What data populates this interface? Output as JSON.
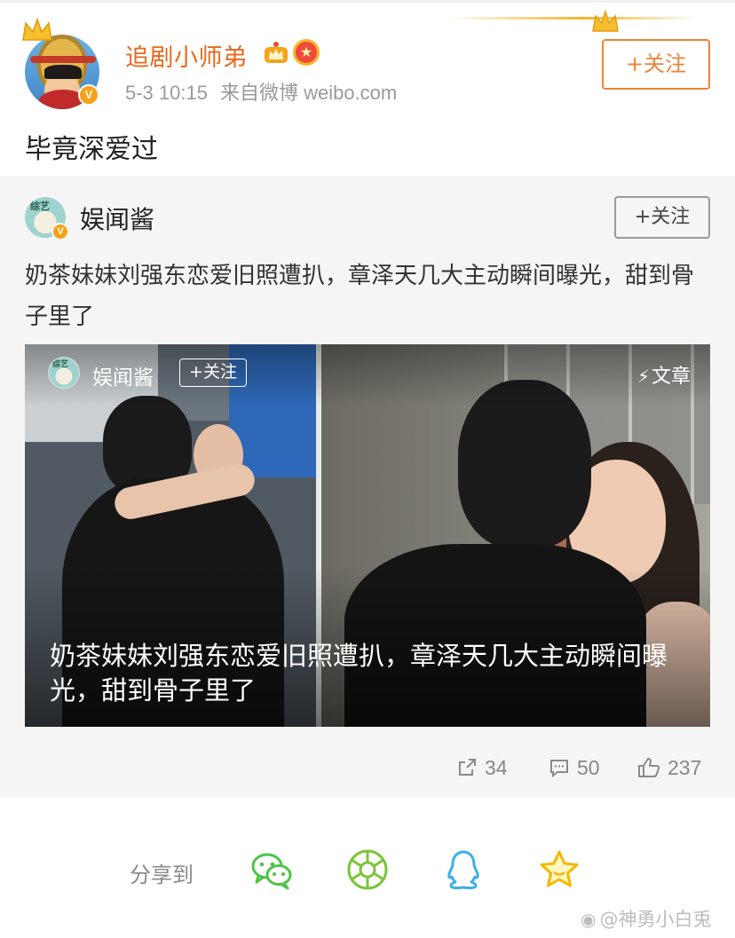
{
  "post": {
    "username": "追剧小师弟",
    "time": "5-3 10:15",
    "source": "来自微博 weibo.com",
    "follow_label": "+关注",
    "text": "毕竟深爱过"
  },
  "repost": {
    "author": "娱闻酱",
    "follow_label": "+关注",
    "text": "奶茶妹妹刘强东恋爱旧照遭扒，章泽天几大主动瞬间曝光，甜到骨子里了",
    "avatar_tag": "综艺",
    "image_overlay": {
      "author": "娱闻酱",
      "follow_label": "+关注",
      "type_label": "文章",
      "title": "奶茶妹妹刘强东恋爱旧照遭扒，章泽天几大主动瞬间曝光，甜到骨子里了"
    },
    "stats": {
      "reposts": "34",
      "comments": "50",
      "likes": "237"
    }
  },
  "share": {
    "label": "分享到",
    "targets": [
      "wechat-icon",
      "moments-icon",
      "qq-icon",
      "favorite-icon"
    ]
  },
  "watermark": "@神勇小白兎",
  "colors": {
    "accent": "#f08236",
    "username": "#e8681b",
    "wechat": "#4ec34a",
    "moments": "#7cc43a",
    "qq": "#3bb0e6",
    "favorite": "#f5b800"
  }
}
